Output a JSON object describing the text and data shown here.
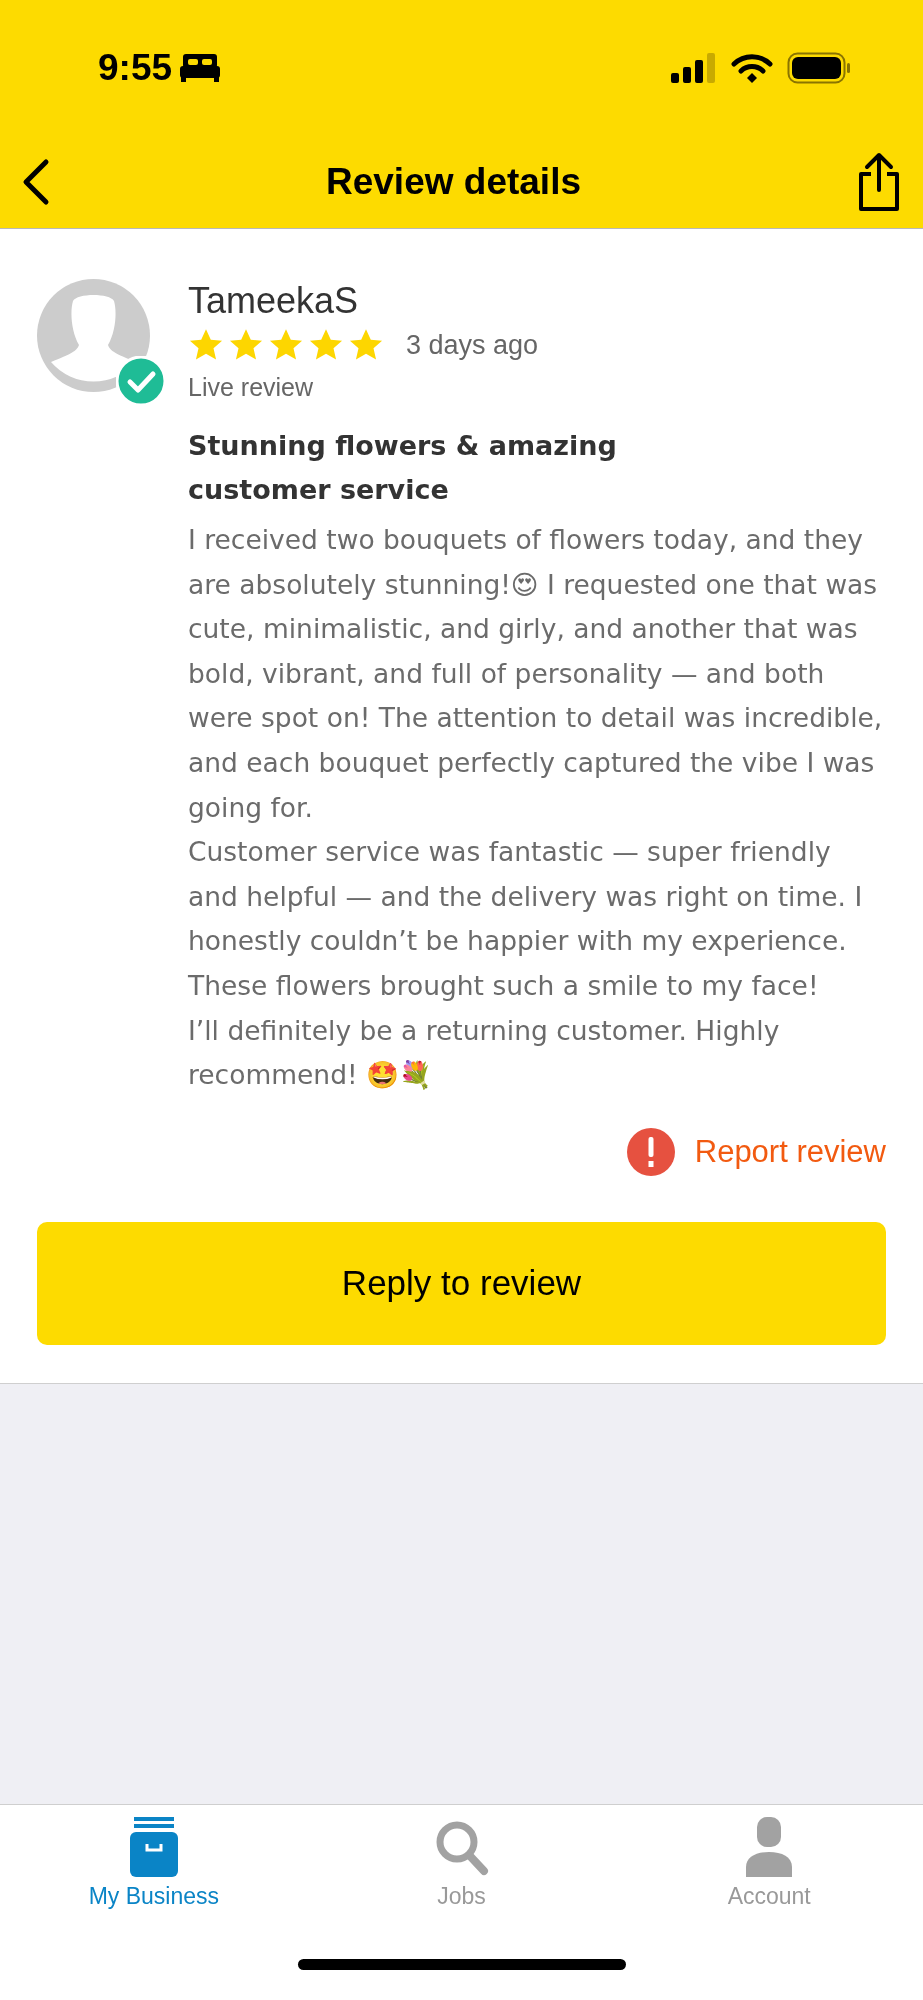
{
  "status_bar": {
    "time": "9:55"
  },
  "header": {
    "title": "Review details"
  },
  "review": {
    "author": "TameekaS",
    "verified": true,
    "stars": 5,
    "age": "3 days ago",
    "status": "Live review",
    "title": "Stunning flowers & amazing customer service",
    "paragraphs": [
      "I received two bouquets of flowers today, and they are absolutely stunning!😍 I requested one that was cute, minimalistic, and girly, and another that was bold, vibrant, and full of personality — and both were spot on! The attention to detail was incredible, and each bouquet perfectly captured the vibe I was going for.",
      "Customer service was fantastic — super friendly and helpful — and the delivery was right on time. I honestly couldn’t be happier with my experience. These flowers brought such a smile to my face!",
      "I’ll definitely be a returning customer. Highly recommend! 🤩💐"
    ],
    "report_link": "Report review"
  },
  "reply_button": "Reply to review",
  "tab_bar": [
    {
      "kind": "business",
      "label": "My Business",
      "selected": true
    },
    {
      "kind": "search",
      "label": "Jobs",
      "selected": false
    },
    {
      "kind": "account",
      "label": "Account",
      "selected": false
    }
  ]
}
